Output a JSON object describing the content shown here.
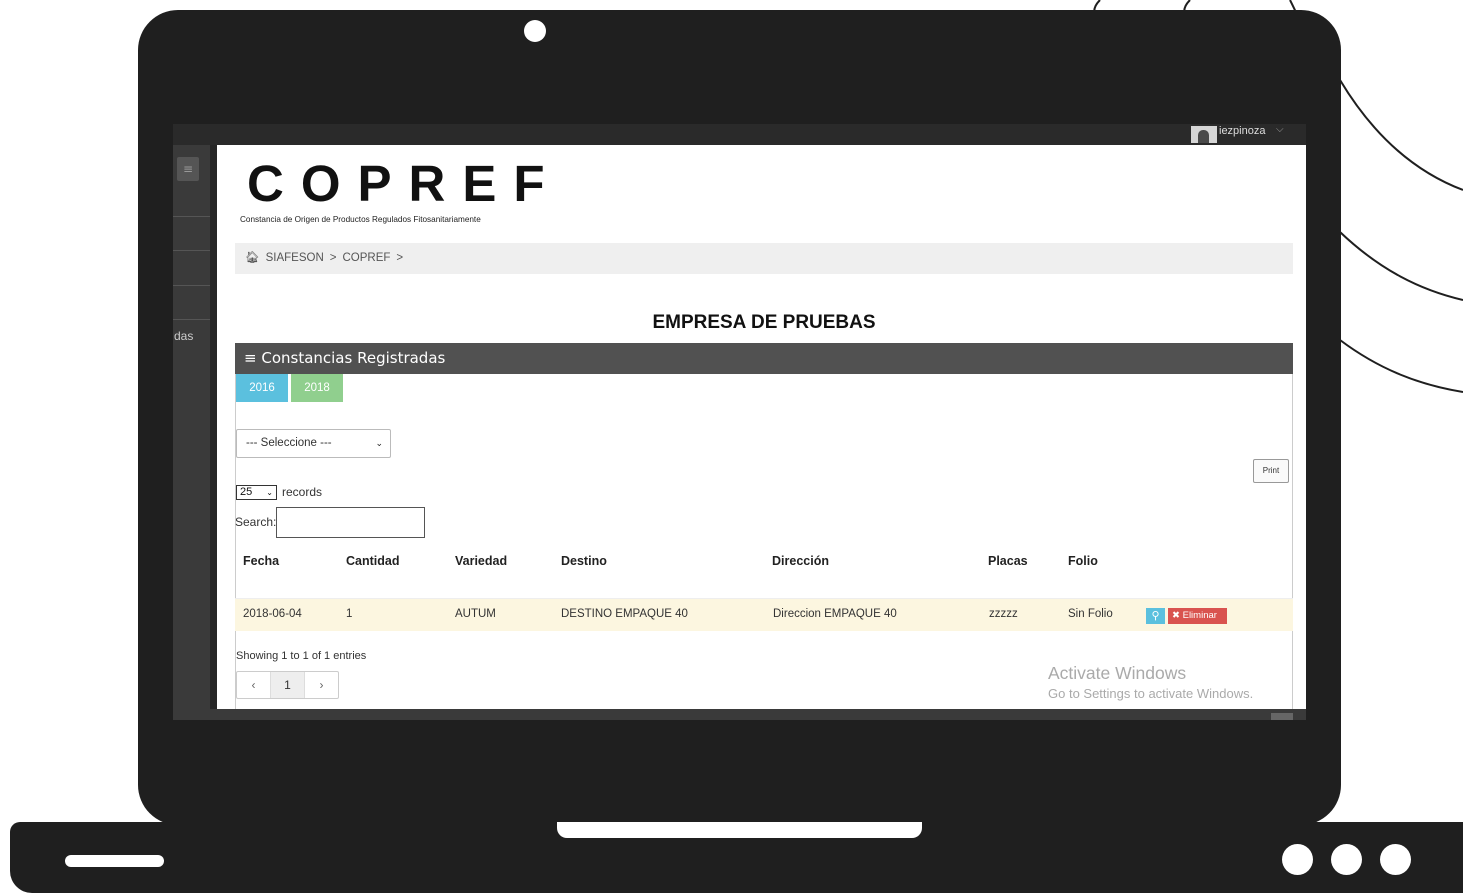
{
  "user": {
    "name": "iezpinoza"
  },
  "sidebar": {
    "partial_label": "das"
  },
  "brand": {
    "logo": "COPREF",
    "subtitle": "Constancia de Origen de Productos Regulados Fitosanitariamente"
  },
  "breadcrumb": [
    "SIAFESON",
    ">",
    "COPREF",
    ">"
  ],
  "company_title": "EMPRESA DE PRUEBAS",
  "panel": {
    "title": "Constancias Registradas",
    "years": [
      {
        "label": "2016",
        "color": "#5bc0de"
      },
      {
        "label": "2018",
        "color": "#90cf8e"
      }
    ],
    "select_value": "--- Seleccione ---",
    "print_label": "Print",
    "records_value": "25",
    "records_label": "records",
    "search_label": "Search:"
  },
  "table": {
    "columns": [
      "Fecha",
      "Cantidad",
      "Variedad",
      "Destino",
      "Dirección",
      "Placas",
      "Folio"
    ],
    "rows": [
      {
        "fecha": "2018-06-04",
        "cantidad": "1",
        "variedad": "AUTUM",
        "destino": "DESTINO EMPAQUE 40",
        "direccion": "Direccion EMPAQUE 40",
        "placas": "zzzzz",
        "folio": "Sin Folio",
        "delete_label": "Eliminar"
      }
    ]
  },
  "footer": {
    "showing": "Showing 1 to 1 of 1 entries",
    "pager": [
      "‹",
      "1",
      "›"
    ]
  },
  "watermark": {
    "title": "Activate Windows",
    "subtitle": "Go to Settings to activate Windows."
  }
}
